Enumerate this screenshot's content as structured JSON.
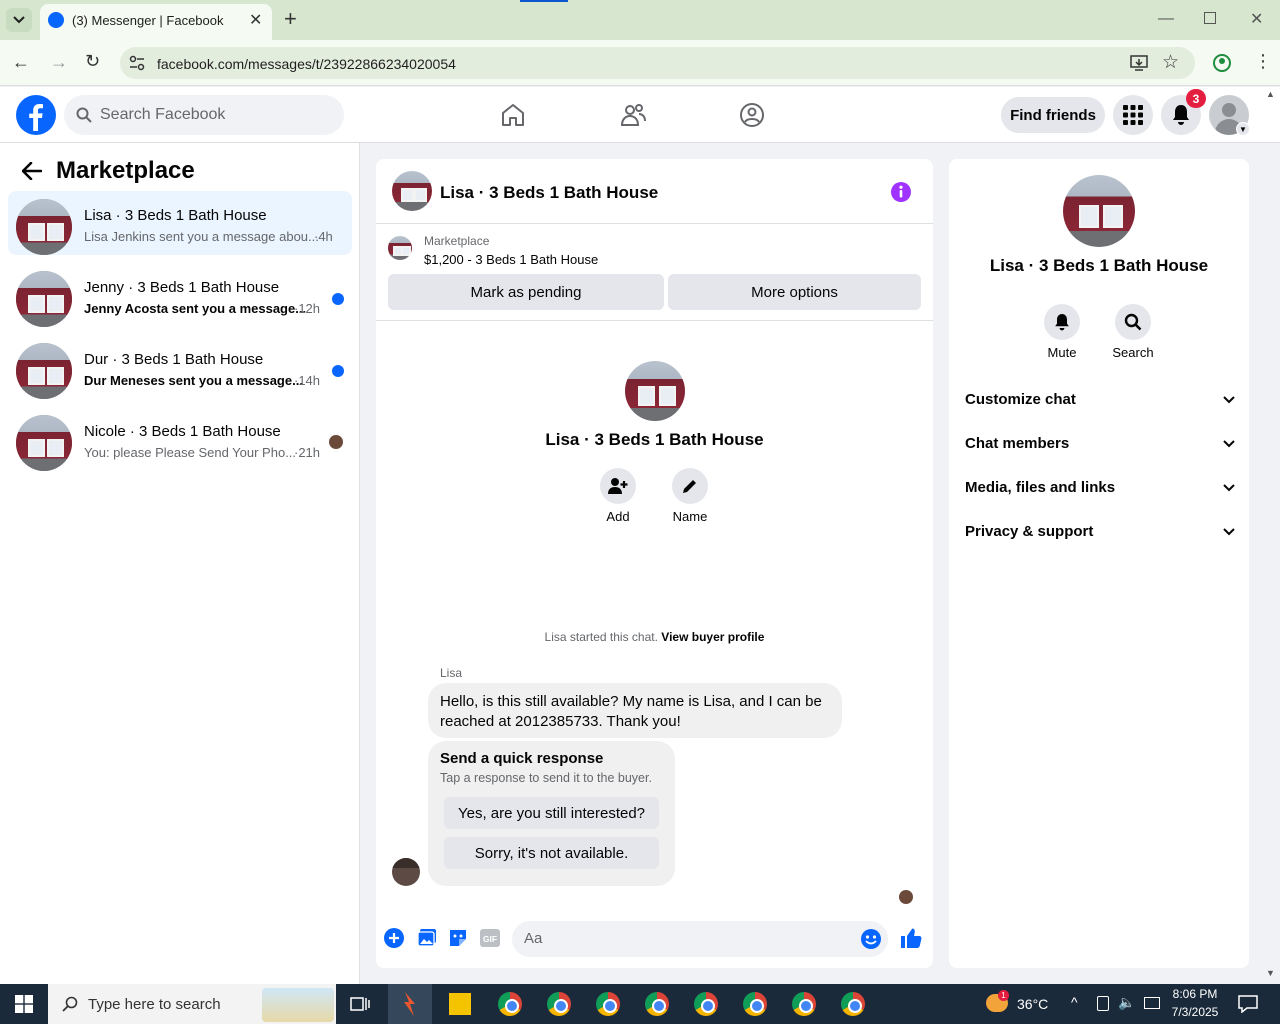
{
  "browser": {
    "tab_title": "(3) Messenger | Facebook",
    "url": "facebook.com/messages/t/23922866234020054"
  },
  "header": {
    "search_placeholder": "Search Facebook",
    "find_friends": "Find friends",
    "notification_count": "3"
  },
  "left": {
    "title": "Marketplace",
    "conversations": [
      {
        "title": "Lisa · 3 Beds 1 Bath House",
        "preview": "Lisa Jenkins sent you a message abou...",
        "time": "·4h",
        "selected": true,
        "unread": false
      },
      {
        "title": "Jenny · 3 Beds 1 Bath House",
        "preview": "Jenny Acosta sent you a message...",
        "time": "·12h",
        "selected": false,
        "unread": true
      },
      {
        "title": "Dur · 3 Beds 1 Bath House",
        "preview": "Dur Meneses sent you a message...",
        "time": "·14h",
        "selected": false,
        "unread": true
      },
      {
        "title": "Nicole · 3 Beds 1 Bath House",
        "preview": "You: please Please Send Your Pho...",
        "time": "·21h",
        "selected": false,
        "unread": false
      }
    ]
  },
  "chat": {
    "title": "Lisa · 3 Beds 1 Bath House",
    "listing_label": "Marketplace",
    "listing_text": "$1,200 - 3 Beds 1 Bath House",
    "mark_pending": "Mark as pending",
    "more_options": "More options",
    "profile_name": "Lisa · 3 Beds 1 Bath House",
    "add_label": "Add",
    "name_label": "Name",
    "started_text": "Lisa started this chat.",
    "view_buyer": "View buyer profile",
    "sender": "Lisa",
    "message": "Hello, is this still available? My name is Lisa, and I can be reached at 2012385733. Thank you!",
    "quick_title": "Send a quick response",
    "quick_sub": "Tap a response to send it to the buyer.",
    "quick_yes": "Yes, are you still interested?",
    "quick_no": "Sorry, it's not available.",
    "composer_placeholder": "Aa"
  },
  "right": {
    "name": "Lisa · 3 Beds 1 Bath House",
    "mute": "Mute",
    "search": "Search",
    "sections": [
      "Customize chat",
      "Chat members",
      "Media, files and links",
      "Privacy & support"
    ]
  },
  "taskbar": {
    "search_placeholder": "Type here to search",
    "temperature": "36°C",
    "time": "8:06 PM",
    "date": "7/3/2025",
    "weather_badge": "1"
  },
  "colors": {
    "fb_blue": "#0866ff",
    "accent_purple": "#a033ff",
    "badge_red": "#e41e3f"
  }
}
